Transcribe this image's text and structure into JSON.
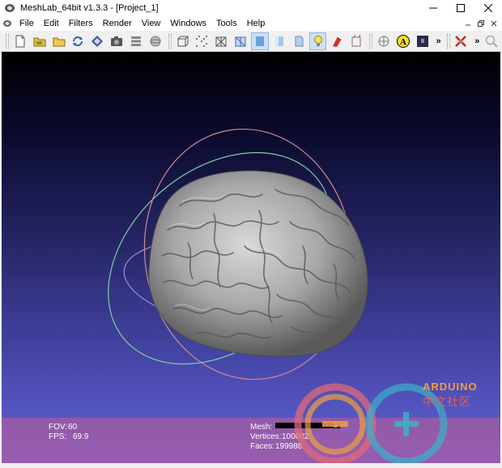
{
  "window": {
    "title": "MeshLab_64bit v1.3.3 - [Project_1]"
  },
  "menu": {
    "items": [
      "File",
      "Edit",
      "Filters",
      "Render",
      "View",
      "Windows",
      "Tools",
      "Help"
    ]
  },
  "toolbar": {
    "icons": [
      "new-icon",
      "open-project-icon",
      "open-icon",
      "reload-icon",
      "save-icon",
      "snapshot-icon",
      "layers-icon",
      "sphere-icon",
      "bbox-icon",
      "points-icon",
      "wireframe-icon",
      "hidden-lines-icon",
      "flat-icon",
      "smooth-icon",
      "texture-icon",
      "light-icon",
      "color-icon",
      "normals-icon",
      "axis-icon",
      "annotation-icon",
      "shader-icon",
      "delete-icon",
      "search-icon"
    ]
  },
  "viewport": {
    "fov_label": "FOV:",
    "fov_value": "60",
    "fps_label": "FPS:",
    "fps_value": "69.9",
    "mesh_label": "Mesh:",
    "mesh_name": "B",
    "vertices_label": "Vertices:",
    "vertices_value": "100002",
    "faces_label": "Faces:",
    "faces_value": "199988"
  },
  "watermark": {
    "brand": "ARDUINO",
    "cn": "中文社区"
  },
  "colors": {
    "bg_top": "#000000",
    "bg_bottom": "#6464d8",
    "info_bar": "#aa5aa0",
    "brain": "#a8a8a8",
    "trackball_red": "#d08080",
    "trackball_green": "#80d0a0",
    "trackball_blue": "#8080e0"
  }
}
